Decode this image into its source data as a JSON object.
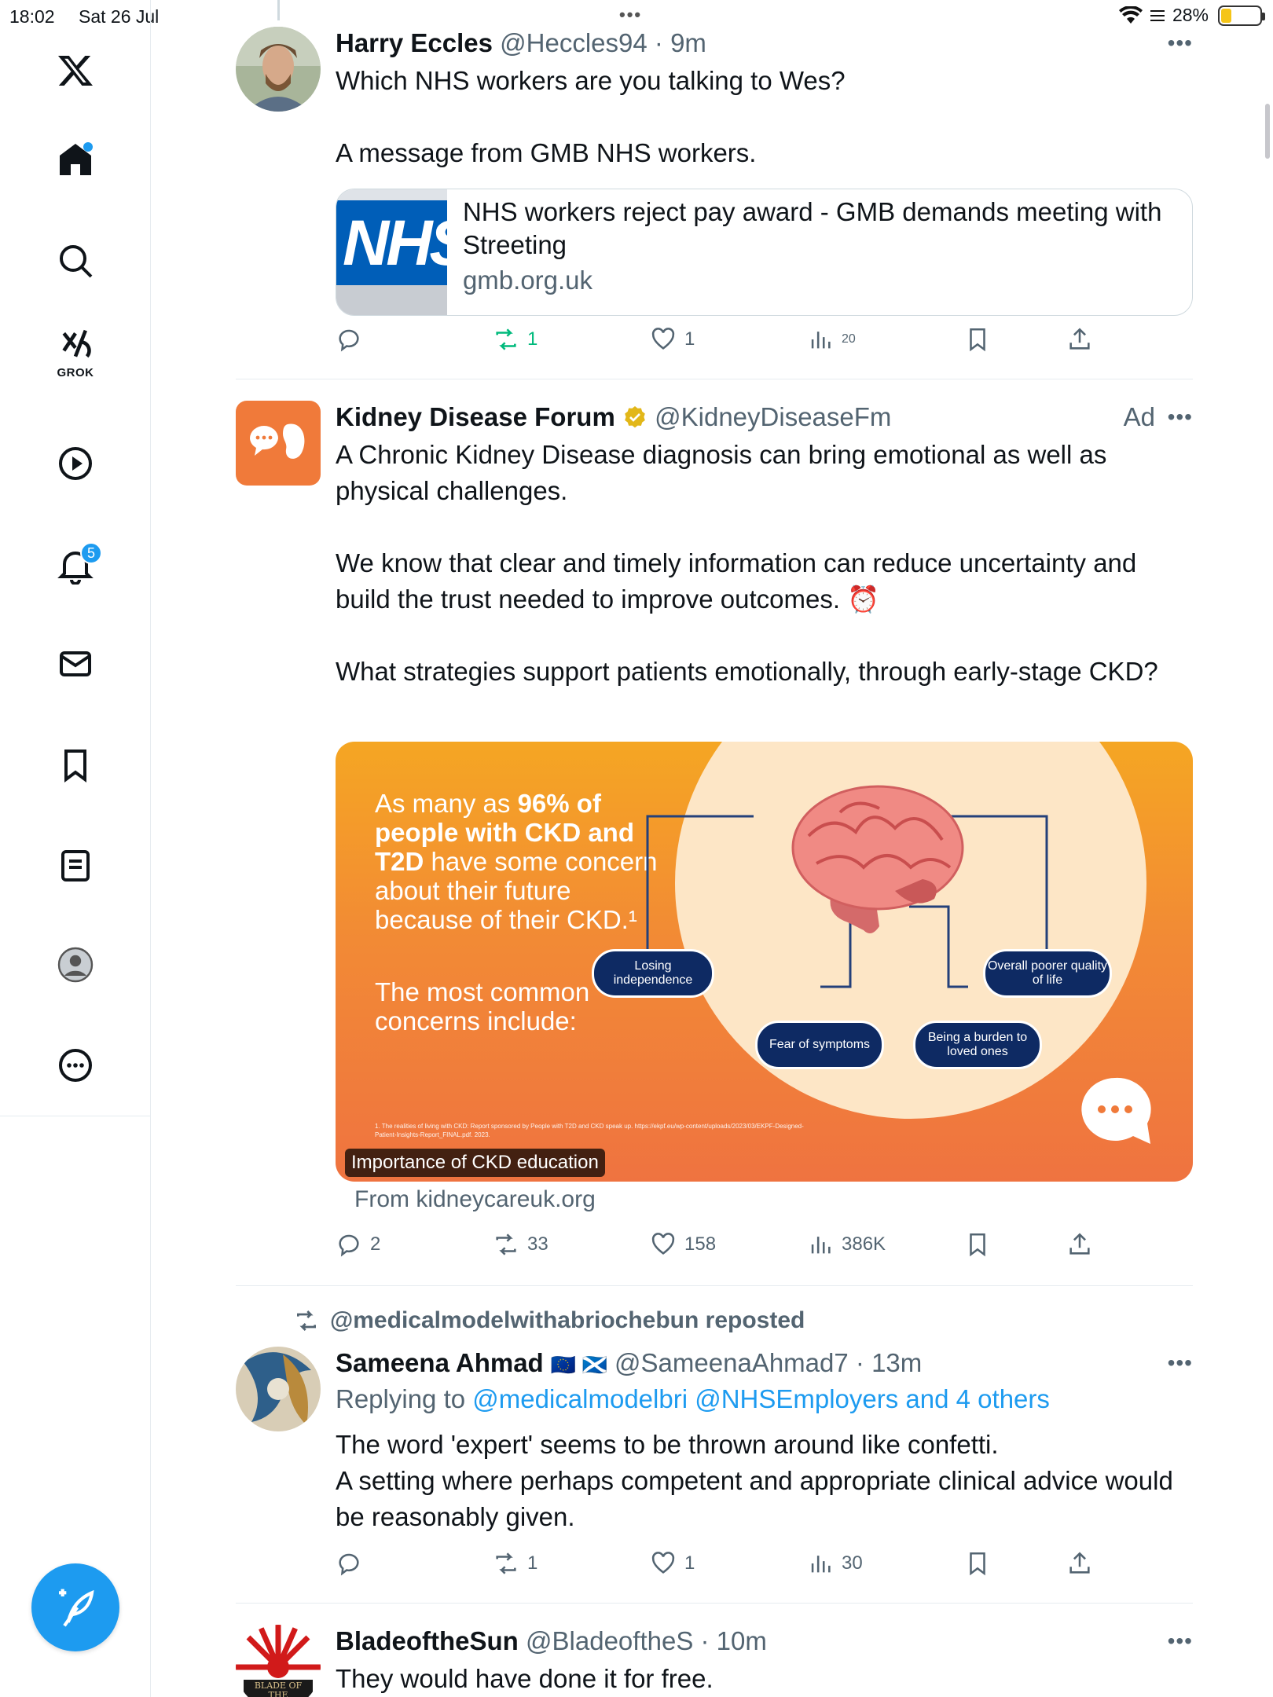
{
  "status_bar": {
    "time": "18:02",
    "date": "Sat 26 Jul",
    "battery_percent": "28%",
    "battery_level": 0.28
  },
  "sidebar": {
    "grok_label": "GROK",
    "notifications_count": "5",
    "home_unread": true
  },
  "accent_color": "#1d9bf0",
  "tweets": [
    {
      "name": "Harry Eccles",
      "handle": "@Heccles94",
      "time": "9m",
      "text": "Which NHS workers are you talking to Wes?\n\nA message from GMB NHS workers.",
      "card": {
        "image_text": "NHS",
        "title": "NHS workers reject pay award - GMB demands meeting with Streeting",
        "domain": "gmb.org.uk"
      },
      "actions": {
        "replies": "",
        "reposts": "1",
        "likes": "1",
        "views": "20"
      }
    },
    {
      "name": "Kidney Disease Forum",
      "handle": "@KidneyDiseaseFm",
      "ad_label": "Ad",
      "text": "A Chronic Kidney Disease diagnosis can bring emotional as well as physical challenges.\n\nWe know that clear and timely information can reduce uncertainty and build the trust needed to improve outcomes. ⏰\n\nWhat strategies support patients emotionally, through early-stage CKD?",
      "media": {
        "headline_pre": "As many as ",
        "headline_bold": "96% of people with CKD and T2D",
        "headline_post": " have some concern about their future because of their CKD.¹",
        "sub": "The most common concerns include:",
        "concerns": [
          "Losing independence",
          "Overall poorer quality of life",
          "Fear of symptoms",
          "Being a burden to loved ones"
        ],
        "footnote": "1.  The realities of living with CKD: Report sponsored by People with T2D and CKD speak up. https://ekpf.eu/wp-content/uploads/2023/03/EKPF-Designed-Patient-Insights-Report_FINAL.pdf. 2023.",
        "alt_label": "Importance of CKD education"
      },
      "from": "From kidneycareuk.org",
      "actions": {
        "replies": "2",
        "reposts": "33",
        "likes": "158",
        "views": "386K"
      }
    },
    {
      "repost_label": "@medicalmodelwithabriochebun reposted",
      "name": "Sameena Ahmad",
      "flags": "🇪🇺 🏴󠁧󠁢󠁳󠁣󠁴󠁿",
      "handle": "@SameenaAhmad7",
      "time": "13m",
      "replying_prefix": "Replying to ",
      "replying_to": "@medicalmodelbri @NHSEmployers and 4 others",
      "text": "The word 'expert' seems to be thrown around like confetti.\nA setting where perhaps competent and appropriate clinical advice would be reasonably given.",
      "actions": {
        "replies": "",
        "reposts": "1",
        "likes": "1",
        "views": "30"
      }
    },
    {
      "name": "BladeoftheSun",
      "handle": "@BladeoftheS",
      "time": "10m",
      "text": "They would have done it for free.",
      "avatar_text": "BLADE OF THE"
    }
  ]
}
